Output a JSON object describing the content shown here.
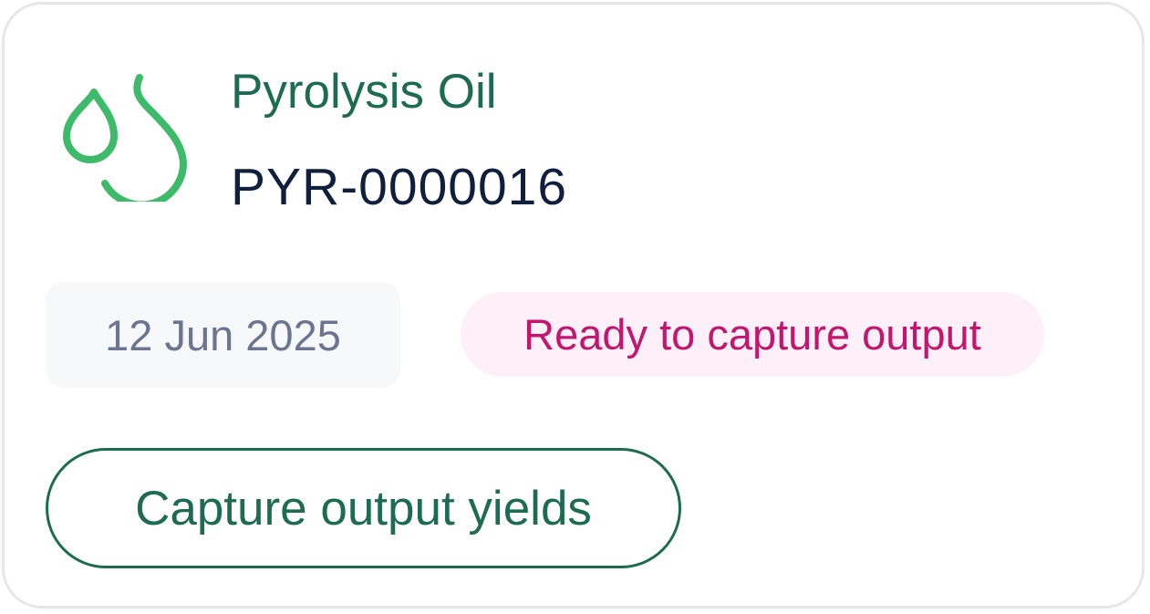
{
  "card": {
    "icon": "oil-drops-icon",
    "title": "Pyrolysis Oil",
    "code": "PYR-0000016",
    "date": "12 Jun 2025",
    "status": "Ready to capture output",
    "action_label": "Capture output yields"
  },
  "colors": {
    "accent_green": "#1d6b52",
    "icon_green": "#3dba6a",
    "status_pink": "#c2166f",
    "status_bg": "#fdf0f8",
    "code_navy": "#0f1f3d",
    "date_gray": "#6b7491",
    "border": "#e5e7eb"
  }
}
